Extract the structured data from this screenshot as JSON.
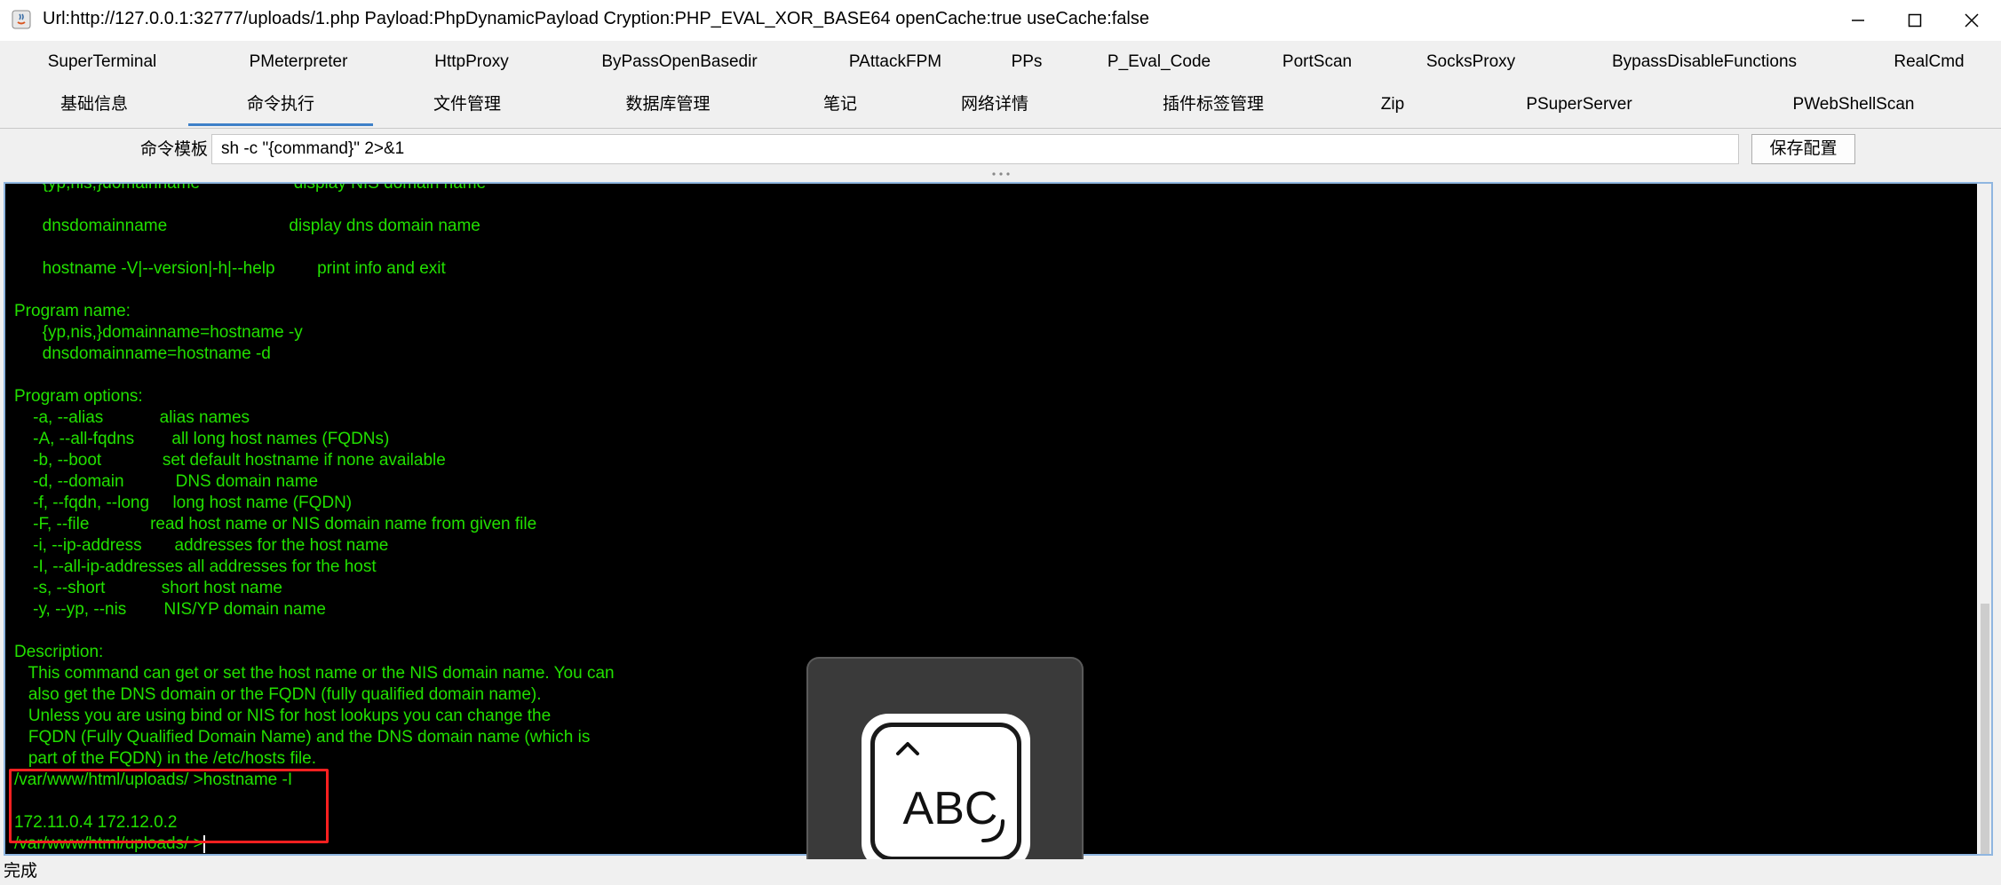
{
  "window": {
    "title": "Url:http://127.0.0.1:32777/uploads/1.php Payload:PhpDynamicPayload Cryption:PHP_EVAL_XOR_BASE64 openCache:true useCache:false"
  },
  "tabs_row1": [
    {
      "label": "SuperTerminal"
    },
    {
      "label": "PMeterpreter"
    },
    {
      "label": "HttpProxy"
    },
    {
      "label": "ByPassOpenBasedir"
    },
    {
      "label": "PAttackFPM"
    },
    {
      "label": "PPs"
    },
    {
      "label": "P_Eval_Code"
    },
    {
      "label": "PortScan"
    },
    {
      "label": "SocksProxy"
    },
    {
      "label": "BypassDisableFunctions"
    },
    {
      "label": "RealCmd"
    }
  ],
  "tabs_row2": [
    {
      "label": "基础信息"
    },
    {
      "label": "命令执行"
    },
    {
      "label": "文件管理"
    },
    {
      "label": "数据库管理"
    },
    {
      "label": "笔记"
    },
    {
      "label": "网络详情"
    },
    {
      "label": "插件标签管理"
    },
    {
      "label": "Zip"
    },
    {
      "label": "PSuperServer"
    },
    {
      "label": "PWebShellScan"
    }
  ],
  "active_tab": "命令执行",
  "command_template": {
    "label": "命令模板",
    "value": "sh -c \"{command}\" 2>&1",
    "save_label": "保存配置"
  },
  "terminal": {
    "lines": [
      "      {yp,nis,}domainname                    display NIS domain name",
      "",
      "      dnsdomainname                          display dns domain name",
      "",
      "      hostname -V|--version|-h|--help         print info and exit",
      "",
      "Program name:",
      "      {yp,nis,}domainname=hostname -y",
      "      dnsdomainname=hostname -d",
      "",
      "Program options:",
      "    -a, --alias            alias names",
      "    -A, --all-fqdns        all long host names (FQDNs)",
      "    -b, --boot             set default hostname if none available",
      "    -d, --domain           DNS domain name",
      "    -f, --fqdn, --long     long host name (FQDN)",
      "    -F, --file             read host name or NIS domain name from given file",
      "    -i, --ip-address       addresses for the host name",
      "    -I, --all-ip-addresses all addresses for the host",
      "    -s, --short            short host name",
      "    -y, --yp, --nis        NIS/YP domain name",
      "",
      "Description:",
      "   This command can get or set the host name or the NIS domain name. You can",
      "   also get the DNS domain or the FQDN (fully qualified domain name).",
      "   Unless you are using bind or NIS for host lookups you can change the",
      "   FQDN (Fully Qualified Domain Name) and the DNS domain name (which is",
      "   part of the FQDN) in the /etc/hosts file.",
      "/var/www/html/uploads/ >hostname -I",
      "",
      "172.11.0.4 172.12.0.2",
      "/var/www/html/uploads/ >"
    ]
  },
  "status": "完成",
  "ime": {
    "text": "ABC"
  },
  "colors": {
    "terminal_bg": "#000000",
    "terminal_text": "#22e000",
    "highlight": "#ff2020",
    "active_tab": "#3e80c8"
  }
}
